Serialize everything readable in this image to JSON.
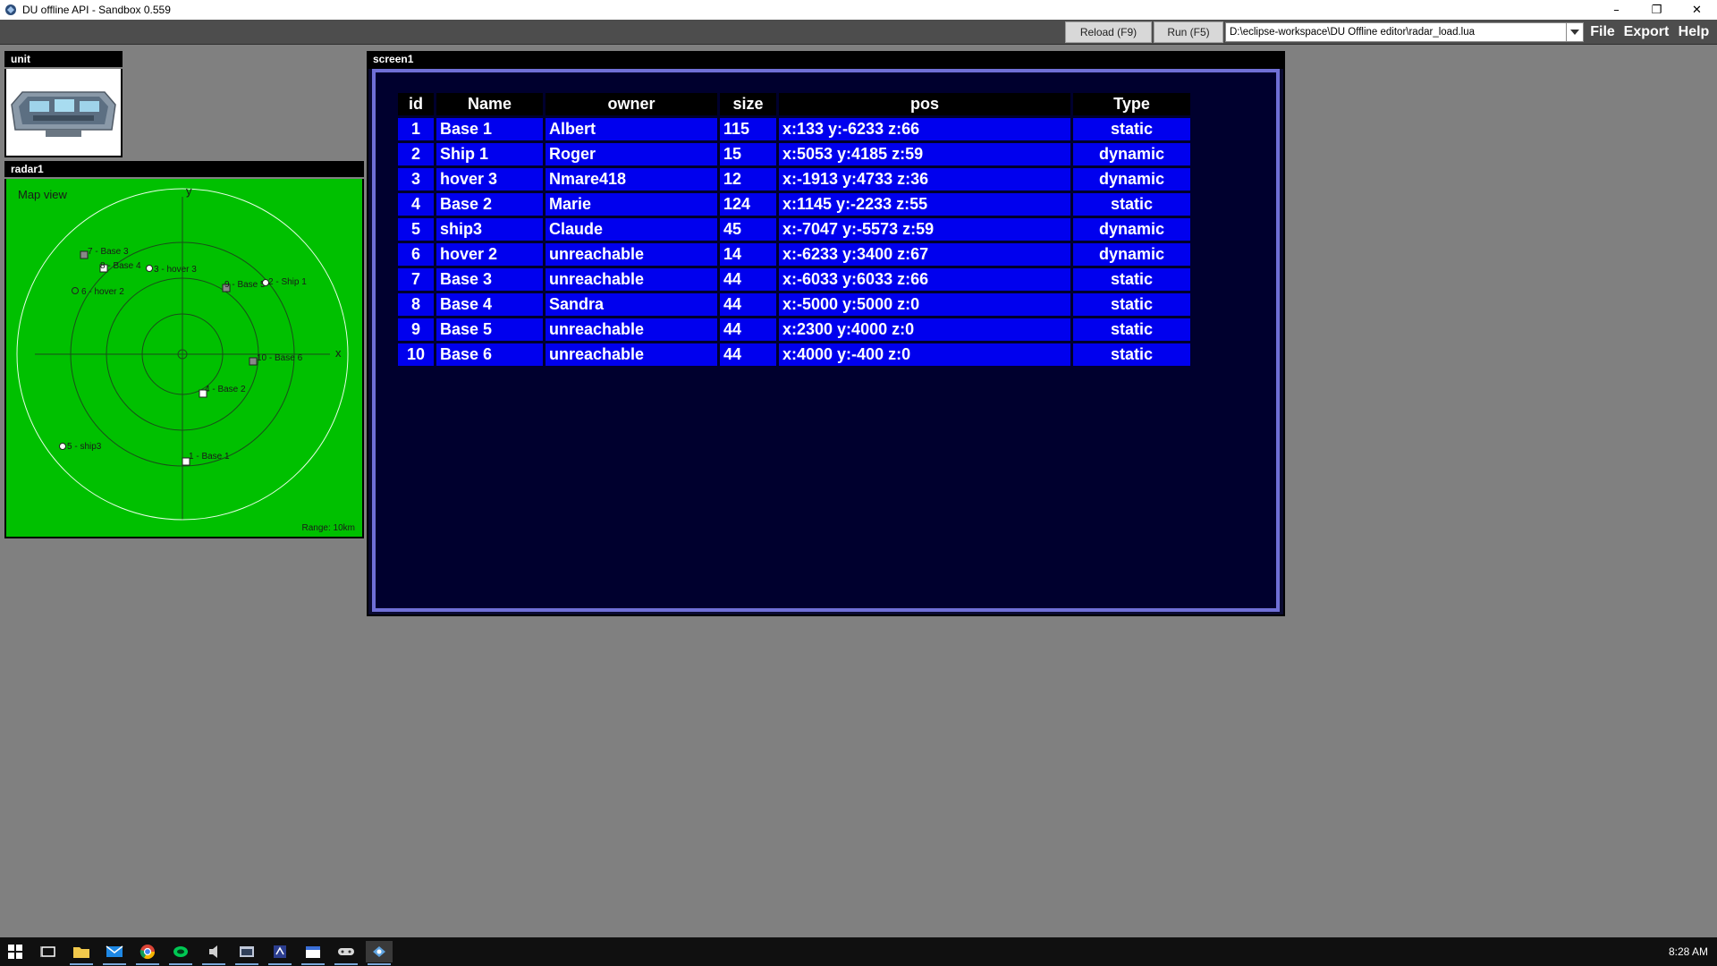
{
  "window": {
    "title": "DU offline API - Sandbox 0.559"
  },
  "toolbar": {
    "reload_label": "Reload (F9)",
    "run_label": "Run (F5)",
    "script_path": "D:\\eclipse-workspace\\DU Offline editor\\radar_load.lua",
    "file_label": "File",
    "export_label": "Export",
    "help_label": "Help"
  },
  "panels": {
    "unit_title": "unit",
    "radar_title": "radar1",
    "screen_title": "screen1"
  },
  "radar": {
    "map_view_label": "Map view",
    "axis_x": "x",
    "axis_y": "y",
    "range_label": "Range: 10km",
    "markers": [
      {
        "label": "7 - Base 3",
        "shape": "square"
      },
      {
        "label": "8 - Base 4",
        "shape": "square"
      },
      {
        "label": "3 - hover 3",
        "shape": "circle"
      },
      {
        "label": "6 - hover 2",
        "shape": "circle"
      },
      {
        "label": "9 - Base 5",
        "shape": "square"
      },
      {
        "label": "2 - Ship 1",
        "shape": "circle"
      },
      {
        "label": "10 - Base 6",
        "shape": "square"
      },
      {
        "label": "4 - Base 2",
        "shape": "square"
      },
      {
        "label": "5 - ship3",
        "shape": "circle"
      },
      {
        "label": "1 - Base 1",
        "shape": "square"
      }
    ]
  },
  "table": {
    "columns": [
      "id",
      "Name",
      "owner",
      "size",
      "pos",
      "Type"
    ],
    "rows": [
      {
        "id": "1",
        "name": "Base 1",
        "owner": "Albert",
        "size": "115",
        "pos": "x:133 y:-6233 z:66",
        "type": "static"
      },
      {
        "id": "2",
        "name": "Ship 1",
        "owner": "Roger",
        "size": "15",
        "pos": "x:5053 y:4185 z:59",
        "type": "dynamic"
      },
      {
        "id": "3",
        "name": "hover 3",
        "owner": "Nmare418",
        "size": "12",
        "pos": "x:-1913 y:4733 z:36",
        "type": "dynamic"
      },
      {
        "id": "4",
        "name": "Base 2",
        "owner": "Marie",
        "size": "124",
        "pos": "x:1145 y:-2233 z:55",
        "type": "static"
      },
      {
        "id": "5",
        "name": "ship3",
        "owner": "Claude",
        "size": "45",
        "pos": "x:-7047 y:-5573 z:59",
        "type": "dynamic"
      },
      {
        "id": "6",
        "name": "hover 2",
        "owner": "unreachable",
        "size": "14",
        "pos": "x:-6233 y:3400 z:67",
        "type": "dynamic"
      },
      {
        "id": "7",
        "name": "Base 3",
        "owner": "unreachable",
        "size": "44",
        "pos": "x:-6033 y:6033 z:66",
        "type": "static"
      },
      {
        "id": "8",
        "name": "Base 4",
        "owner": "Sandra",
        "size": "44",
        "pos": "x:-5000 y:5000 z:0",
        "type": "static"
      },
      {
        "id": "9",
        "name": "Base 5",
        "owner": "unreachable",
        "size": "44",
        "pos": "x:2300 y:4000 z:0",
        "type": "static"
      },
      {
        "id": "10",
        "name": "Base 6",
        "owner": "unreachable",
        "size": "44",
        "pos": "x:4000 y:-400 z:0",
        "type": "static"
      }
    ]
  },
  "taskbar": {
    "clock": "8:28 AM",
    "icons": [
      "start-icon",
      "task-view-icon",
      "file-explorer-icon",
      "mail-icon",
      "chrome-icon",
      "green-app-icon",
      "audio-app-icon",
      "terminal-icon",
      "editor-icon",
      "calendar-icon",
      "game-icon",
      "du-app-icon"
    ]
  }
}
